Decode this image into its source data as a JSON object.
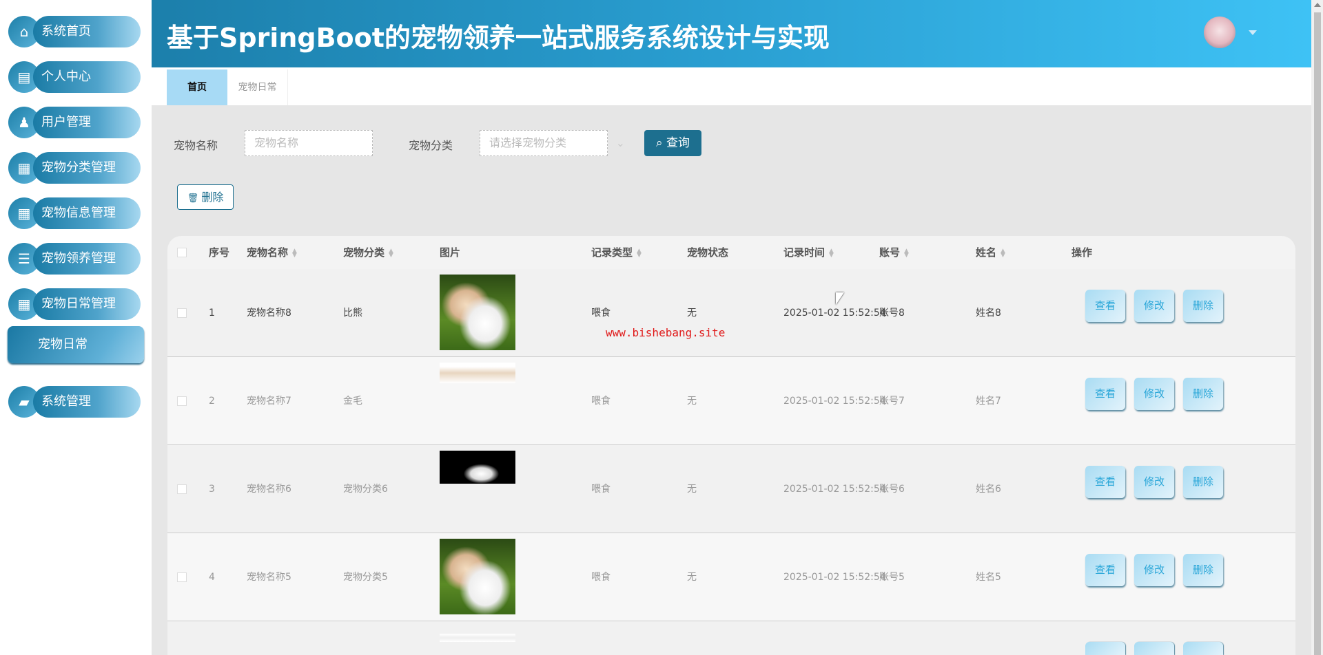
{
  "app_title": "基于SpringBoot的宠物领养一站式服务系统设计与实现",
  "sidebar": {
    "items": [
      {
        "label": "系统首页",
        "icon": "home-icon"
      },
      {
        "label": "个人中心",
        "icon": "wallet-icon"
      },
      {
        "label": "用户管理",
        "icon": "user-icon"
      },
      {
        "label": "宠物分类管理",
        "icon": "grid-icon"
      },
      {
        "label": "宠物信息管理",
        "icon": "grid-icon"
      },
      {
        "label": "宠物领养管理",
        "icon": "list-icon"
      },
      {
        "label": "宠物日常管理",
        "icon": "grid-icon"
      }
    ],
    "active_sub": "宠物日常",
    "system": {
      "label": "系统管理",
      "icon": "briefcase-icon"
    }
  },
  "tabs": [
    {
      "label": "首页"
    },
    {
      "label": "宠物日常"
    }
  ],
  "search": {
    "name_label": "宠物名称",
    "name_placeholder": "宠物名称",
    "category_label": "宠物分类",
    "category_placeholder": "请选择宠物分类",
    "query_label": "查询",
    "delete_label": "删除"
  },
  "table": {
    "headers": [
      "序号",
      "宠物名称",
      "宠物分类",
      "图片",
      "记录类型",
      "宠物状态",
      "记录时间",
      "账号",
      "姓名",
      "操作"
    ],
    "rows": [
      {
        "index": "1",
        "name": "宠物名称8",
        "category": "比熊",
        "type": "喂食",
        "status": "无",
        "time": "2025-01-02 15:52:54",
        "account": "账号8",
        "person": "姓名8"
      },
      {
        "index": "2",
        "name": "宠物名称7",
        "category": "金毛",
        "type": "喂食",
        "status": "无",
        "time": "2025-01-02 15:52:54",
        "account": "账号7",
        "person": "姓名7"
      },
      {
        "index": "3",
        "name": "宠物名称6",
        "category": "宠物分类6",
        "type": "喂食",
        "status": "无",
        "time": "2025-01-02 15:52:54",
        "account": "账号6",
        "person": "姓名6"
      },
      {
        "index": "4",
        "name": "宠物名称5",
        "category": "宠物分类5",
        "type": "喂食",
        "status": "无",
        "time": "2025-01-02 15:52:54",
        "account": "账号5",
        "person": "姓名5"
      }
    ],
    "actions": {
      "view": "查看",
      "edit": "修改",
      "delete": "删除"
    }
  },
  "watermark": "www.bishebang.site",
  "colors": {
    "primary": "#1d6f8f",
    "header_start": "#1c7fab",
    "header_end": "#3ec2f5",
    "watermark": "#e01c1c"
  }
}
